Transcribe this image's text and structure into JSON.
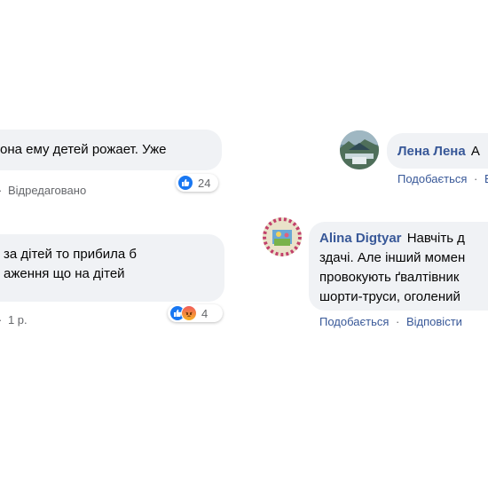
{
  "left_comments": [
    {
      "lines": [
        "она ему детей рожает. Уже"
      ],
      "meta_parts": [
        "·",
        "Відредаговано"
      ],
      "reaction_count": "24",
      "reaction_icons": [
        "like-icon"
      ]
    },
    {
      "lines": [
        "за дітей то прибила б",
        "аження що на дітей"
      ],
      "meta_parts": [
        "·",
        "1 р."
      ],
      "reaction_count": "4",
      "reaction_icons": [
        "like-icon",
        "angry-icon"
      ]
    }
  ],
  "right_comments": [
    {
      "author": "Лена Лена",
      "text_after_author": "А",
      "actions": [
        "Подобається",
        "·",
        "Ві"
      ],
      "avatar_icon": "avatar-landscape"
    },
    {
      "author": "Alina Digtyar",
      "first_line_text": "Навчіть д",
      "lines": [
        "здачі. Але інший момен",
        "провокують ґвалтівник",
        "шорти-труси, оголений"
      ],
      "actions": [
        "Подобається",
        "·",
        "Відповісти"
      ],
      "avatar_icon": "avatar-floral"
    }
  ],
  "colors": {
    "bubble_bg": "#f0f2f5",
    "author_link": "#385898",
    "meta_text": "#65676b",
    "like_blue": "#1877f2"
  }
}
